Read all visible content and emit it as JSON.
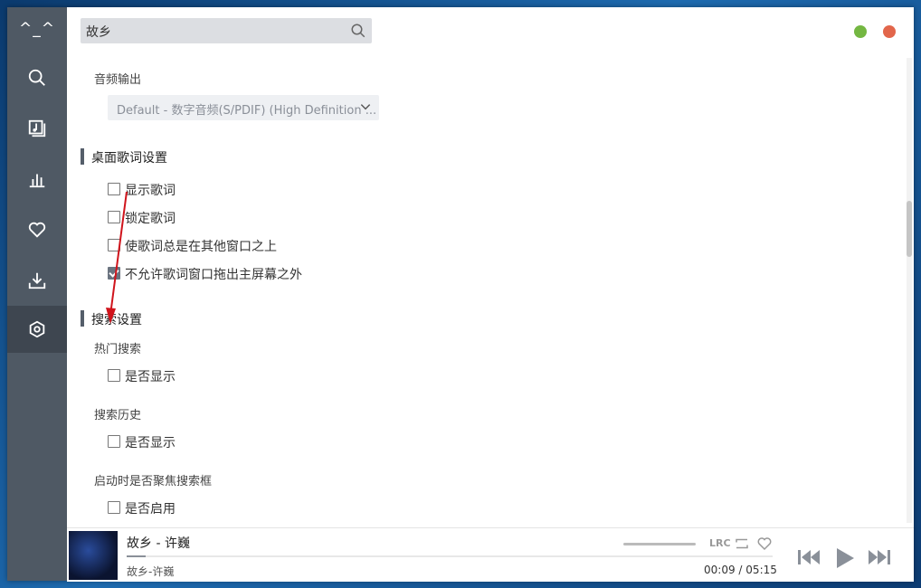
{
  "app": {
    "logo": "^_^"
  },
  "search": {
    "value": "故乡",
    "icon": "search-icon"
  },
  "window_controls": {
    "minimize_color": "#74b742",
    "close_color": "#e2664b"
  },
  "sidebar": {
    "items": [
      {
        "name": "search-icon"
      },
      {
        "name": "music-library-icon"
      },
      {
        "name": "chart-icon"
      },
      {
        "name": "heart-icon"
      },
      {
        "name": "download-icon"
      },
      {
        "name": "settings-icon",
        "active": true
      }
    ]
  },
  "settings": {
    "audio_output": {
      "label": "音频输出",
      "selected": "Default - 数字音频(S/PDIF) (High Definition ..."
    },
    "desktop_lyrics": {
      "title": "桌面歌词设置",
      "options": [
        {
          "label": "显示歌词",
          "checked": false
        },
        {
          "label": "锁定歌词",
          "checked": false
        },
        {
          "label": "使歌词总是在其他窗口之上",
          "checked": false
        },
        {
          "label": "不允许歌词窗口拖出主屏幕之外",
          "checked": true
        }
      ]
    },
    "search_settings": {
      "title": "搜索设置",
      "hot_search": {
        "label": "热门搜索",
        "option": "是否显示"
      },
      "history": {
        "label": "搜索历史",
        "option": "是否显示"
      },
      "focus": {
        "label": "启动时是否聚焦搜索框",
        "option": "是否启用"
      }
    }
  },
  "player": {
    "title": "故乡 - 许巍",
    "subtitle": "故乡-许巍",
    "current_time": "00:09",
    "total_time": "05:15",
    "time_separator": "/",
    "progress": 0.03,
    "lyric_icon": "LRC"
  },
  "colors": {
    "sidebar": "#4f5964",
    "accent": "#555e6a"
  }
}
